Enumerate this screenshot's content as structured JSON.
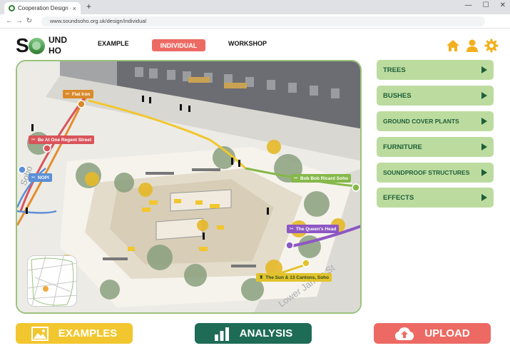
{
  "browser": {
    "tab_title": "Cooperation Design -Sou...",
    "tab_close": "×",
    "new_tab": "+",
    "url": "www.soundsoho.org.uk/design/individual",
    "back": "←",
    "forward": "→",
    "reload": "↻",
    "minimize": "—",
    "maximize": "☐",
    "close": "✕"
  },
  "logo": {
    "s": "S",
    "und": "UND",
    "ho": "HO"
  },
  "nav": {
    "example": "EXAMPLE",
    "individual": "INDIVIDUAL",
    "workshop": "WORKSHOP"
  },
  "pois": [
    {
      "label": "Flat Iron",
      "icon": "✂"
    },
    {
      "label": "Be At One Regent Street",
      "icon": "✂"
    },
    {
      "label": "NOPI",
      "icon": "✂"
    },
    {
      "label": "Bob Bob Ricard Soho",
      "icon": "✂"
    },
    {
      "label": "The Queen's Head",
      "icon": "✂"
    },
    {
      "label": "The Sun & 13 Cantons, Soho",
      "icon": "♜"
    }
  ],
  "street_labels": {
    "left": "Soho",
    "right": "Lower James St"
  },
  "panel": {
    "trees": "TREES",
    "bushes": "BUSHES",
    "ground_cover": "GROUND COVER PLANTS",
    "furniture": "FURNITURE",
    "soundproof": "SOUNDPROOF STRUCTURES",
    "effects": "EFFECTS"
  },
  "buttons": {
    "examples": "EXAMPLES",
    "analysis": "ANALYSIS",
    "upload": "UPLOAD"
  },
  "colors": {
    "accent_red": "#ec6a63",
    "panel_green": "#bcdc9f",
    "dark_green": "#1f5e3a",
    "yellow": "#f2c62e",
    "teal": "#1e6b56",
    "poi_orange": "#d98a2b",
    "poi_red": "#d9545a",
    "poi_blue": "#5c8fd6",
    "poi_green": "#86b84a",
    "poi_purple": "#8d57c4",
    "poi_yellow": "#e2c32c"
  }
}
